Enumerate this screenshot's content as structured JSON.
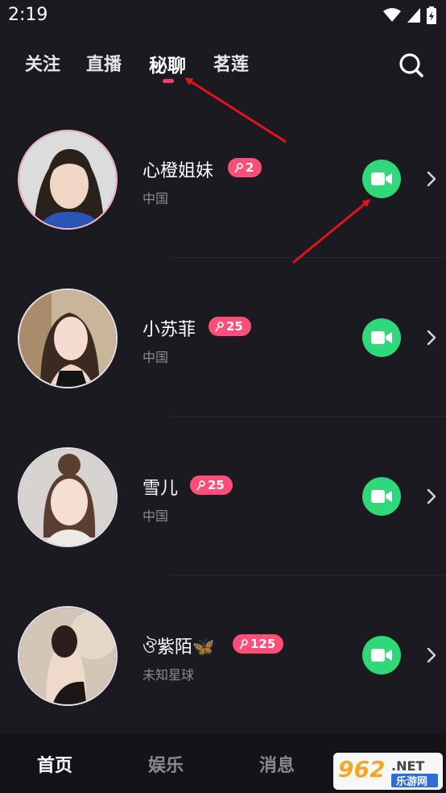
{
  "status_bar": {
    "time": "2:19"
  },
  "top_tabs": [
    {
      "label": "关注"
    },
    {
      "label": "直播"
    },
    {
      "label": "秘聊"
    },
    {
      "label": "茗莲"
    }
  ],
  "active_tab": "秘聊",
  "contacts": [
    {
      "name": "心橙姐妹",
      "badge": "2",
      "location": "中国"
    },
    {
      "name": "小苏菲",
      "badge": "25",
      "location": "中国"
    },
    {
      "name": "雪儿",
      "badge": "25",
      "location": "中国"
    },
    {
      "name": "ঔ紫陌🦋",
      "badge": "125",
      "location": "未知星球"
    }
  ],
  "bottom_nav": [
    {
      "label": "首页"
    },
    {
      "label": "娱乐"
    },
    {
      "label": "消息"
    }
  ],
  "watermark": {
    "brand": "962",
    "tld": ".NET",
    "sub": "乐游网"
  },
  "colors": {
    "accent": "#ff4f78",
    "call_green": "#2fd97a",
    "background": "#1b1a20",
    "arrow": "#e0141a"
  }
}
